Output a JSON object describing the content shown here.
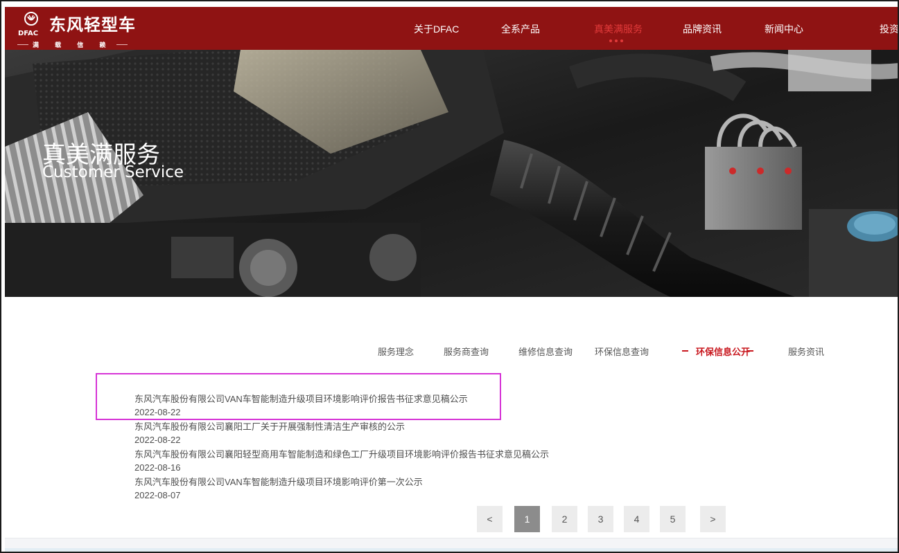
{
  "brand": {
    "logo_text": "东风轻型车",
    "slogan": "满 载 信 赖",
    "brand_mark": "DFAC"
  },
  "nav": {
    "items": [
      {
        "label": "关于DFAC"
      },
      {
        "label": "全系产品"
      },
      {
        "label": "真美满服务"
      },
      {
        "label": "品牌资讯"
      },
      {
        "label": "新闻中心"
      },
      {
        "label": "投资"
      }
    ],
    "active_index": 2
  },
  "banner": {
    "title": "真美满服务",
    "subtitle": "Customer Service"
  },
  "subnav": {
    "items": [
      {
        "label": "服务理念"
      },
      {
        "label": "服务商查询"
      },
      {
        "label": "维修信息查询"
      },
      {
        "label": "环保信息查询"
      },
      {
        "label": "环保信息公开"
      },
      {
        "label": "服务资讯"
      }
    ],
    "active_index": 4
  },
  "list": {
    "items": [
      {
        "title": "东风汽车股份有限公司VAN车智能制造升级项目环境影响评价报告书征求意见稿公示",
        "date": "2022-08-22"
      },
      {
        "title": "东风汽车股份有限公司襄阳工厂关于开展强制性清洁生产审核的公示",
        "date": "2022-08-22"
      },
      {
        "title": "东风汽车股份有限公司襄阳轻型商用车智能制造和绿色工厂升级项目环境影响评价报告书征求意见稿公示",
        "date": "2022-08-16"
      },
      {
        "title": "东风汽车股份有限公司VAN车智能制造升级项目环境影响评价第一次公示",
        "date": "2022-08-07"
      }
    ]
  },
  "pagination": {
    "prev": "<",
    "next": ">",
    "pages": [
      "1",
      "2",
      "3",
      "4",
      "5"
    ],
    "current": "1"
  },
  "colors": {
    "header_bg": "#8f1313",
    "accent": "#c8161d",
    "highlight": "#d633d6"
  }
}
